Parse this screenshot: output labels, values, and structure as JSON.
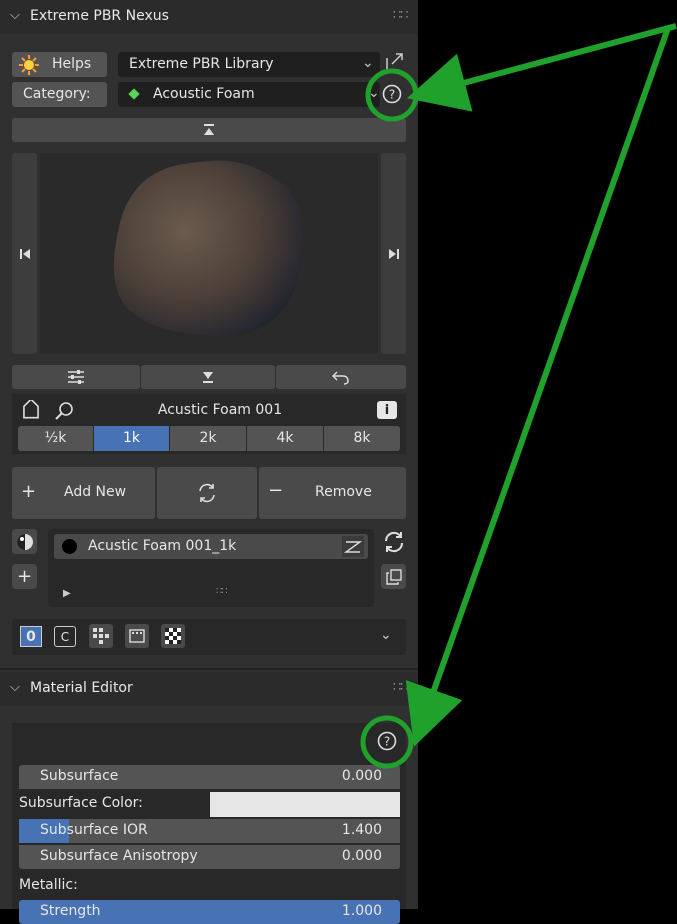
{
  "panel": {
    "title": "Extreme PBR Nexus",
    "helps_label": "Helps",
    "library_value": "Extreme PBR Library",
    "category_label": "Category:",
    "category_value": "Acoustic Foam"
  },
  "asset": {
    "name": "Acustic Foam 001",
    "resolutions": [
      "½k",
      "1k",
      "2k",
      "4k",
      "8k"
    ],
    "active_resolution": "1k",
    "add_label": "Add New",
    "remove_label": "Remove",
    "material_slot": "Acustic Foam 001_1k",
    "pass_index": "0",
    "c_badge": "C"
  },
  "material_editor": {
    "title": "Material Editor",
    "rows": [
      {
        "label": "Subsurface",
        "value": "0.000"
      },
      {
        "label": "Subsurface Color:"
      },
      {
        "label": "Subsurface IOR",
        "value": "1.400",
        "fill": 0.13
      },
      {
        "label": "Subsurface Anisotropy",
        "value": "0.000"
      },
      {
        "label": "Metallic:"
      },
      {
        "label": "Strength",
        "value": "1.000",
        "fill": 1.0
      }
    ]
  },
  "annotation": {
    "color": "#1fa12b",
    "highlight": "help-icon"
  },
  "colors": {
    "accent": "#4772b3",
    "panel": "#303030"
  }
}
